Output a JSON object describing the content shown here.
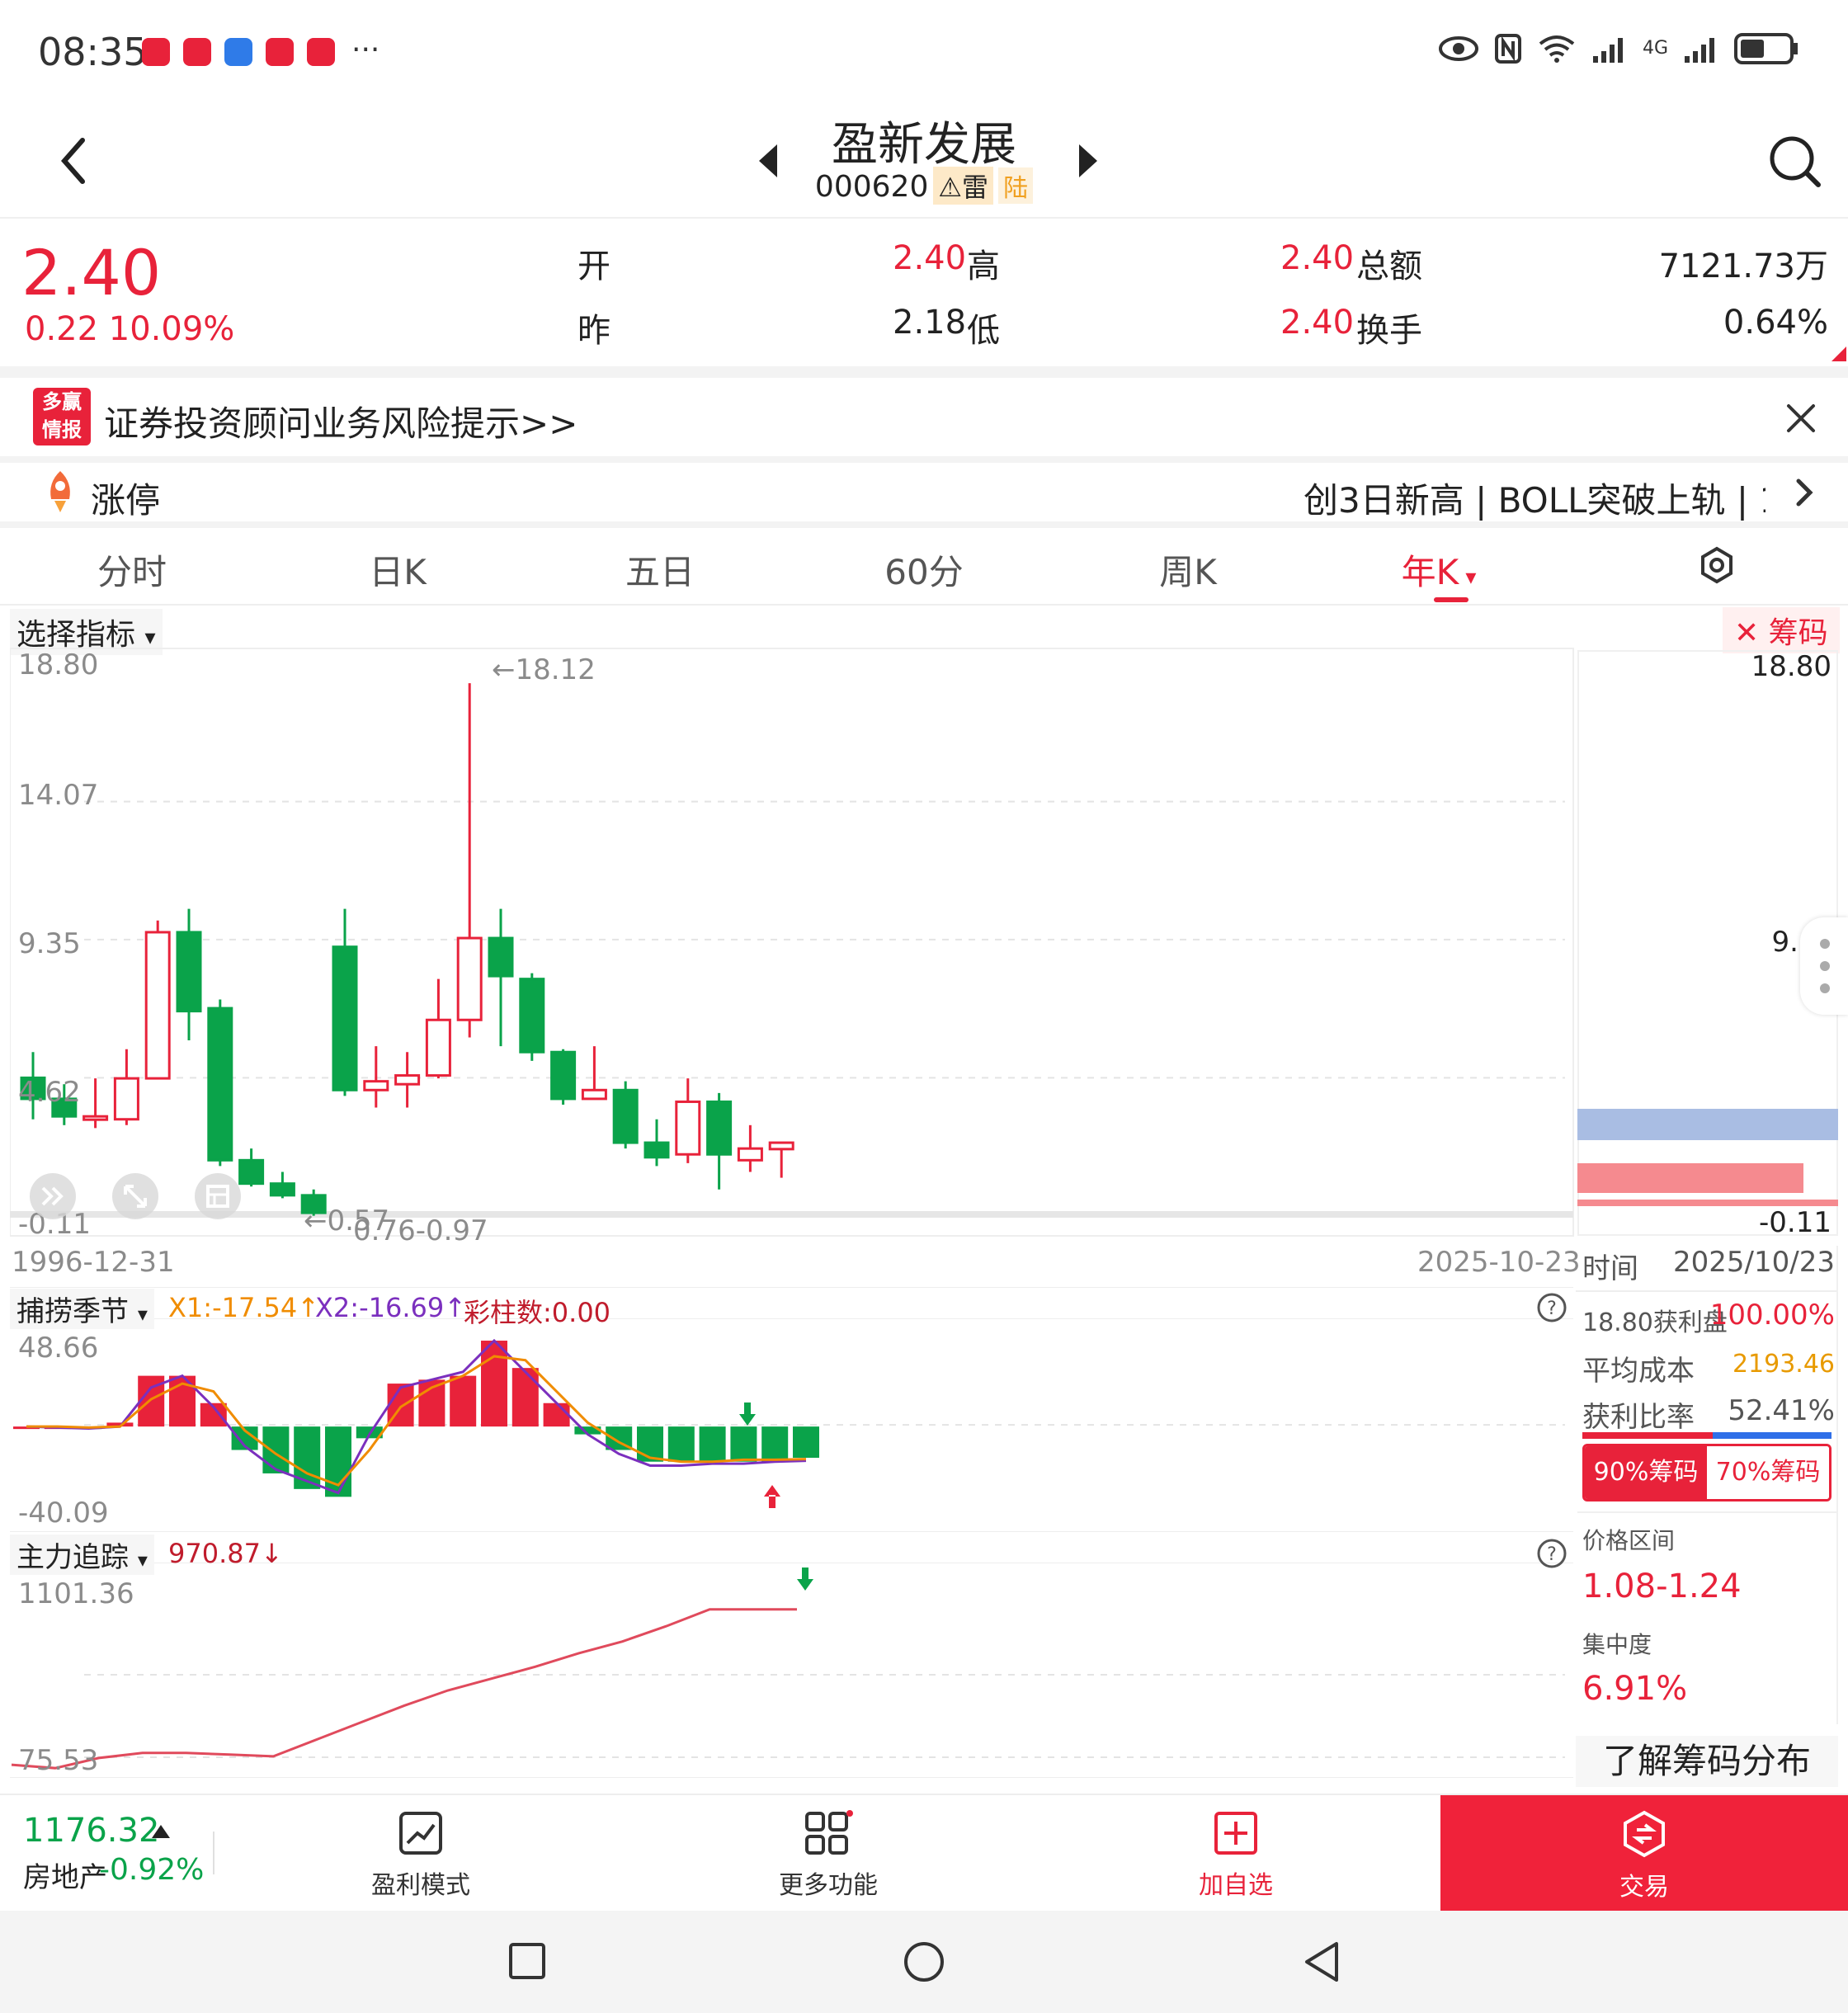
{
  "status_bar": {
    "time": "08:35",
    "more": "···",
    "network": "4G"
  },
  "header": {
    "stock_name": "盈新发展",
    "stock_code": "000620",
    "tag_warn": "雷",
    "tag_lu": "陆"
  },
  "quote": {
    "price": "2.40",
    "change": "0.22",
    "change_pct": "10.09%",
    "open_label": "开",
    "open_value": "2.40",
    "prev_label": "昨",
    "prev_value": "2.18",
    "high_label": "高",
    "high_value": "2.40",
    "low_label": "低",
    "low_value": "2.40",
    "amount_label": "总额",
    "amount_value": "7121.73万",
    "turnover_label": "换手",
    "turnover_value": "0.64%"
  },
  "news": {
    "logo_top": "多赢",
    "logo_bottom": "情报",
    "text": "证券投资顾问业务风险提示>>"
  },
  "ticker": {
    "left": "涨停",
    "right": "创3日新高 | BOLL突破上轨 | 1"
  },
  "tabs": [
    {
      "label": "分时"
    },
    {
      "label": "日K"
    },
    {
      "label": "五日"
    },
    {
      "label": "60分"
    },
    {
      "label": "周K"
    },
    {
      "label": "年K"
    }
  ],
  "chart_toolbar": {
    "indicator_select": "选择指标",
    "chips_label": "筹码"
  },
  "colors": {
    "up": "#e8223a",
    "down": "#0aa34a",
    "ma1": "#f08c00",
    "ma2": "#7b2fbe",
    "chip_profit": "#f58a8f",
    "chip_loss": "#a9bde3"
  },
  "chart_data": [
    {
      "type": "candlestick",
      "name_label": "年K",
      "y_ticks": [
        "18.80",
        "14.07",
        "9.35",
        "4.62",
        "-0.11"
      ],
      "ylim": [
        -0.11,
        18.8
      ],
      "x_start_label": "1996-12-31",
      "x_end_label": "2025-10-23",
      "annotations": {
        "max": "←18.12",
        "min": "←0.57",
        "range": "0.76-0.97"
      },
      "candles": [
        {
          "o": 4.62,
          "c": 3.9,
          "h": 5.5,
          "l": 3.2
        },
        {
          "o": 3.9,
          "c": 3.3,
          "h": 4.4,
          "l": 3.0
        },
        {
          "o": 3.3,
          "c": 3.3,
          "h": 4.6,
          "l": 2.9
        },
        {
          "o": 3.2,
          "c": 4.6,
          "h": 5.6,
          "l": 3.0
        },
        {
          "o": 4.6,
          "c": 9.6,
          "h": 10.0,
          "l": 4.6
        },
        {
          "o": 9.6,
          "c": 6.9,
          "h": 10.4,
          "l": 5.9
        },
        {
          "o": 7.0,
          "c": 1.8,
          "h": 7.3,
          "l": 1.6
        },
        {
          "o": 1.8,
          "c": 1.0,
          "h": 2.2,
          "l": 0.9
        },
        {
          "o": 1.0,
          "c": 0.6,
          "h": 1.4,
          "l": 0.5
        },
        {
          "o": 0.6,
          "c": 0.0,
          "h": 0.8,
          "l": -0.1
        },
        {
          "o": 9.1,
          "c": 4.2,
          "h": 10.4,
          "l": 4.0
        },
        {
          "o": 4.2,
          "c": 4.5,
          "h": 5.7,
          "l": 3.6
        },
        {
          "o": 4.4,
          "c": 4.7,
          "h": 5.5,
          "l": 3.6
        },
        {
          "o": 4.7,
          "c": 6.6,
          "h": 8.0,
          "l": 4.6
        },
        {
          "o": 6.6,
          "c": 9.4,
          "h": 18.12,
          "l": 6.0
        },
        {
          "o": 9.4,
          "c": 8.1,
          "h": 10.4,
          "l": 5.7
        },
        {
          "o": 8.0,
          "c": 5.5,
          "h": 8.2,
          "l": 5.2
        },
        {
          "o": 5.5,
          "c": 3.9,
          "h": 5.6,
          "l": 3.7
        },
        {
          "o": 3.9,
          "c": 4.2,
          "h": 5.7,
          "l": 3.9
        },
        {
          "o": 4.2,
          "c": 2.4,
          "h": 4.5,
          "l": 2.2
        },
        {
          "o": 2.4,
          "c": 1.9,
          "h": 3.2,
          "l": 1.6
        },
        {
          "o": 2.0,
          "c": 3.8,
          "h": 4.6,
          "l": 1.7
        },
        {
          "o": 3.8,
          "c": 2.0,
          "h": 4.1,
          "l": 0.8
        },
        {
          "o": 1.8,
          "c": 2.2,
          "h": 3.0,
          "l": 1.4
        },
        {
          "o": 2.18,
          "c": 2.4,
          "h": 2.4,
          "l": 1.2
        }
      ]
    },
    {
      "type": "bar",
      "indicator_name": "捕捞季节",
      "x1_label": "X1:-17.54↑",
      "x2_label": "X2:-16.69↑",
      "caizhu_label": "彩柱数:0.00",
      "y_ticks": [
        "48.66",
        "-40.09"
      ],
      "ylim": [
        -40.09,
        48.66
      ],
      "values": [
        0,
        0,
        -1,
        2,
        26,
        26,
        12,
        -12,
        -24,
        -32,
        -36,
        -6,
        22,
        24,
        26,
        44,
        30,
        12,
        -4,
        -12,
        -18,
        -18,
        -18,
        -18,
        -18,
        -16
      ],
      "x1": [
        0,
        -0.5,
        -1,
        0,
        20,
        26,
        10,
        -10,
        -22,
        -28,
        -34,
        -4,
        20,
        24,
        28,
        44,
        28,
        12,
        -4,
        -14,
        -20,
        -20,
        -19,
        -19,
        -18,
        -17.54
      ],
      "x2": [
        0,
        0,
        -0.5,
        0,
        14,
        22,
        18,
        -2,
        -14,
        -24,
        -30,
        -12,
        10,
        20,
        26,
        36,
        34,
        18,
        2,
        -8,
        -16,
        -18,
        -18,
        -17,
        -17,
        -16.69
      ]
    },
    {
      "type": "line",
      "indicator_name": "主力追踪",
      "value_label": "970.87↓",
      "y_ticks": [
        "1101.36",
        "75.53"
      ],
      "ylim": [
        75.53,
        1101.36
      ],
      "values": [
        80,
        60,
        120,
        150,
        150,
        140,
        130,
        230,
        330,
        430,
        520,
        590,
        660,
        740,
        810,
        900,
        1000,
        1000,
        1000
      ]
    }
  ],
  "chip_panel": {
    "top_price": "18.80",
    "mid_price": "9.",
    "bottom_price": "-0.11",
    "time_label": "时间",
    "time_value": "2025/10/23",
    "profit_label": "18.80获利盘",
    "profit_value": "100.00%",
    "avg_cost_label": "平均成本",
    "avg_cost_value": "2193.46",
    "profit_ratio_label": "获利比率",
    "profit_ratio_value": "52.41%",
    "tab_90": "90%筹码",
    "tab_70": "70%筹码",
    "range_label": "价格区间",
    "range_value": "1.08-1.24",
    "concentration_label": "集中度",
    "concentration_value": "6.91%",
    "learn_more": "了解筹码分布"
  },
  "bottom_bar": {
    "index_value": "1176.32",
    "index_name": "房地产",
    "index_change": "-0.92%",
    "profit_mode": "盈利模式",
    "more_functions": "更多功能",
    "add_watch": "加自选",
    "trade": "交易"
  }
}
